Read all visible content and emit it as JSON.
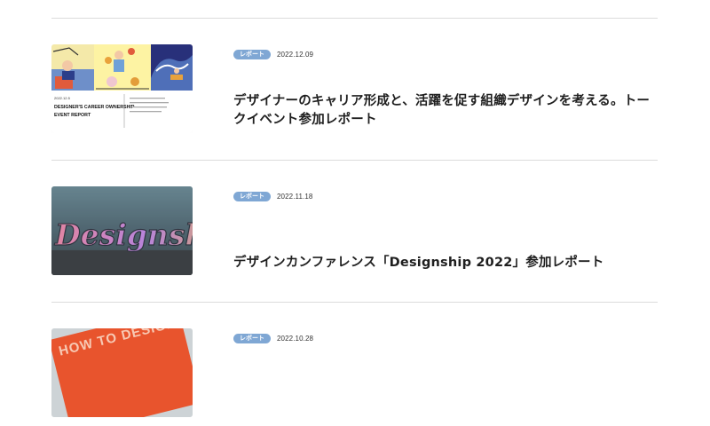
{
  "articles": [
    {
      "badge": "レポート",
      "date": "2022.12.09",
      "title": "デザイナーのキャリア形成と、活躍を促す組織デザインを考える。トークイベント参加レポート",
      "thumbnail": {
        "kind": "illustration",
        "caption_date": "2022.12.5",
        "caption_line1": "DESIGNER'S CAREER OWNERSHIP",
        "caption_line2": "EVENT REPORT"
      }
    },
    {
      "badge": "レポート",
      "date": "2022.11.18",
      "title": "デザインカンファレンス「Designship 2022」参加レポート",
      "thumbnail": {
        "kind": "photo",
        "sign_text": "Designship"
      }
    },
    {
      "badge": "レポート",
      "date": "2022.10.28",
      "title": "",
      "thumbnail": {
        "kind": "book",
        "cover_text": "HOW TO DESIGN ENGINEER CAREER"
      }
    }
  ],
  "colors": {
    "badge": "#7fa7d4",
    "divider": "#dcdcdc",
    "title": "#1f1f1f"
  }
}
